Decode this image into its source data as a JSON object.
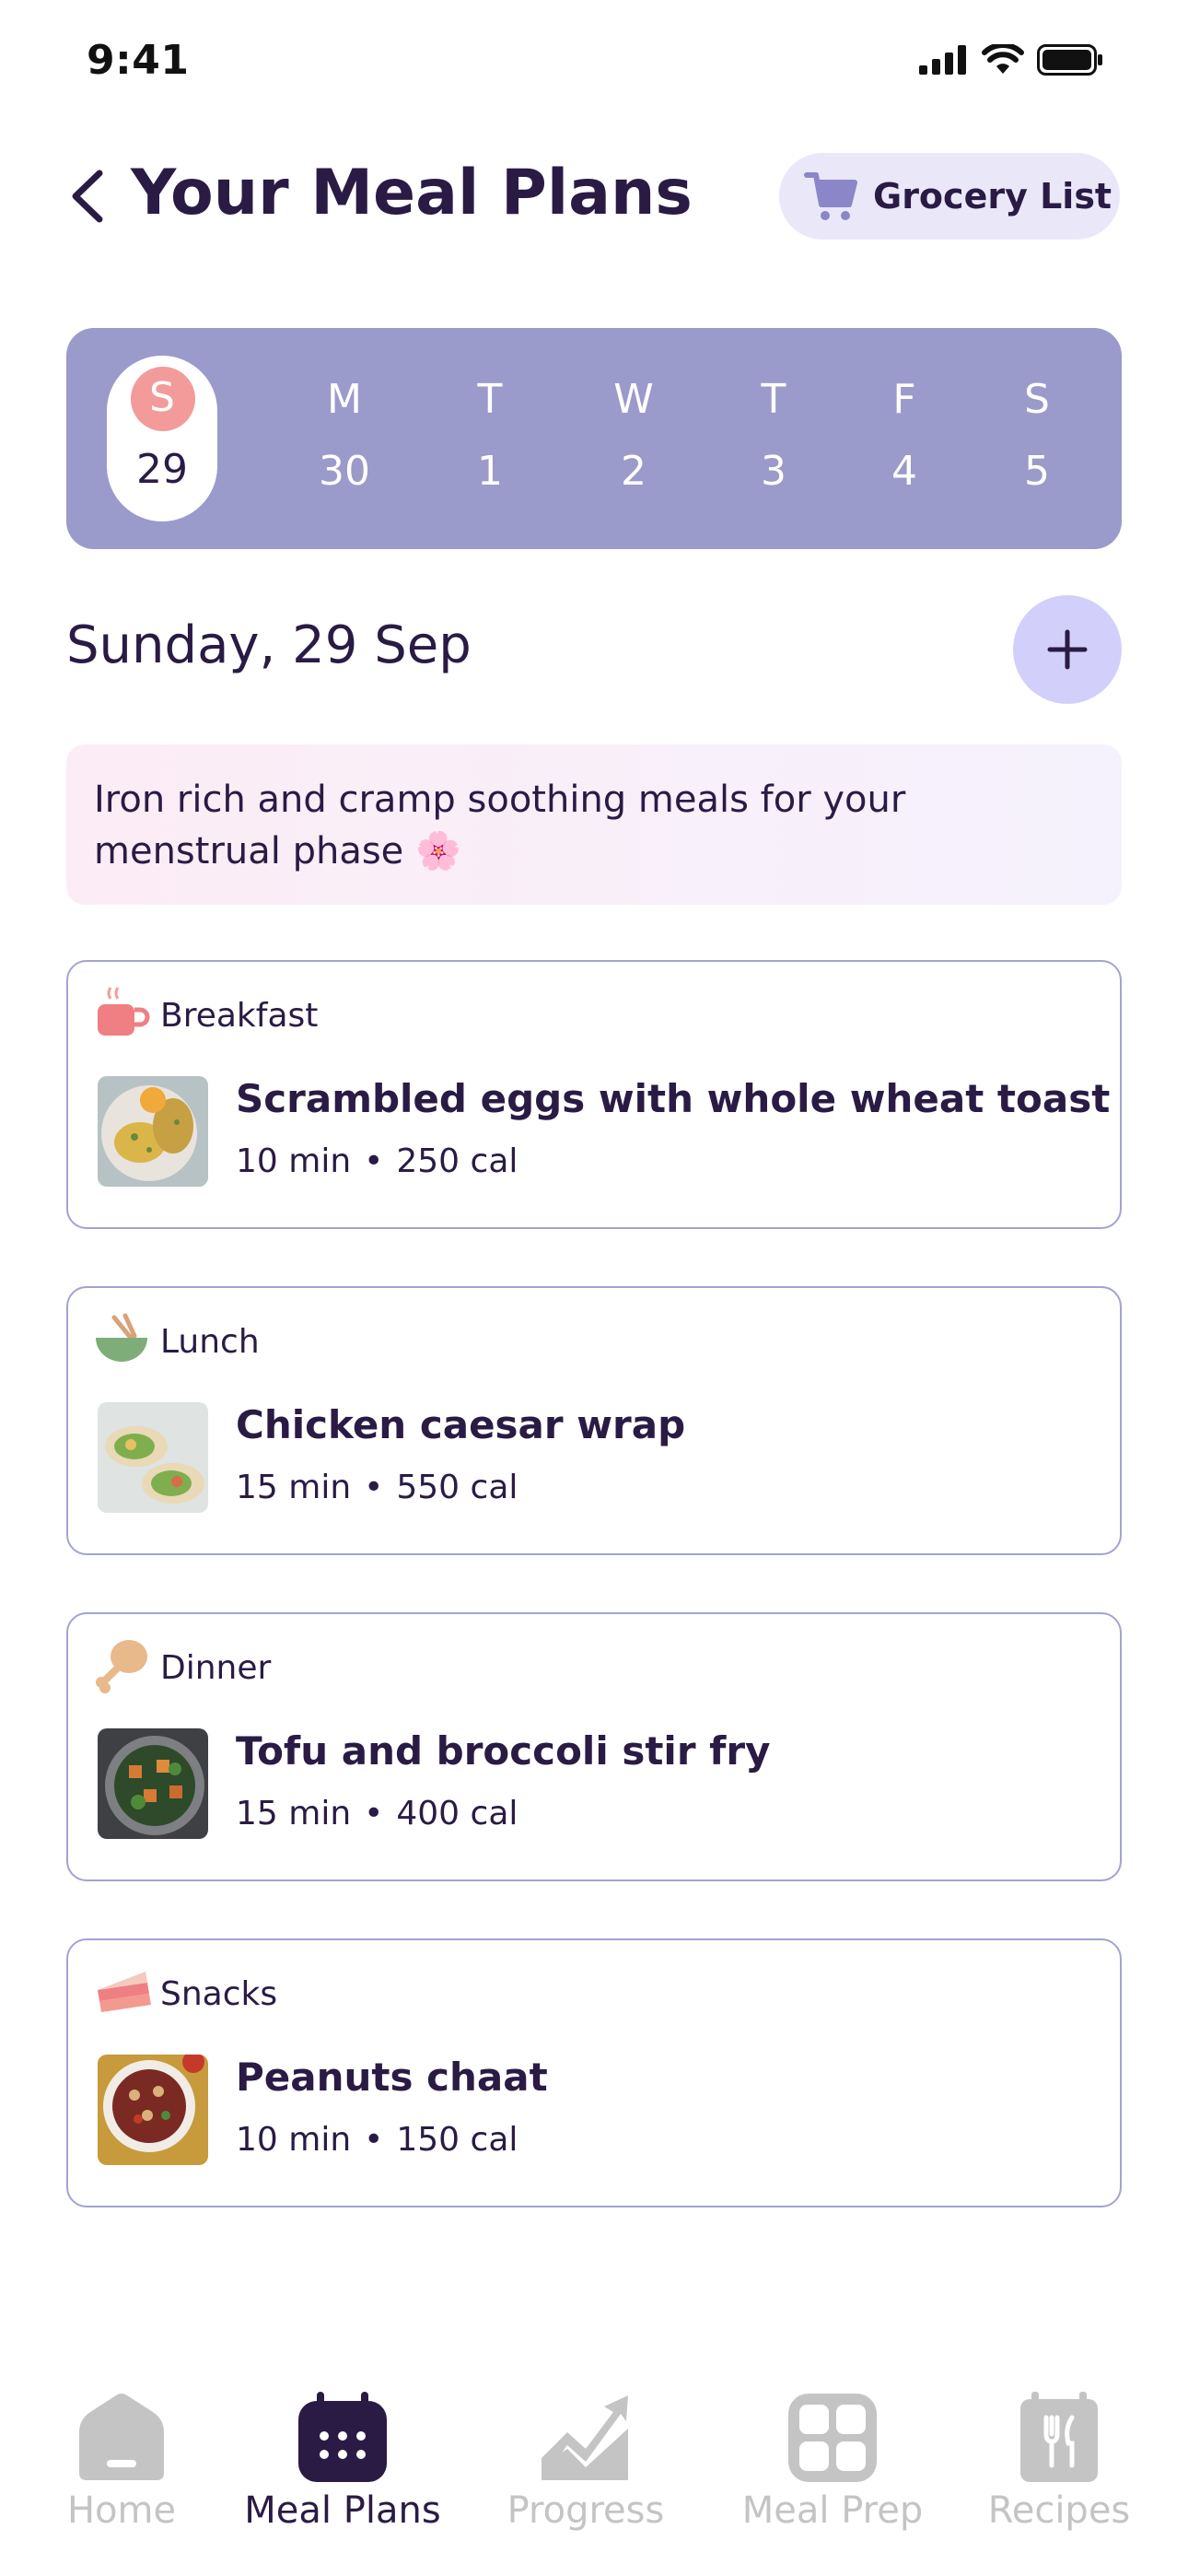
{
  "status_bar": {
    "time": "9:41"
  },
  "header": {
    "title": "Your Meal Plans",
    "grocery_label": "Grocery List"
  },
  "week": [
    {
      "letter": "S",
      "num": "29",
      "active": true
    },
    {
      "letter": "M",
      "num": "30"
    },
    {
      "letter": "T",
      "num": "1"
    },
    {
      "letter": "W",
      "num": "2"
    },
    {
      "letter": "T",
      "num": "3"
    },
    {
      "letter": "F",
      "num": "4"
    },
    {
      "letter": "S",
      "num": "5"
    }
  ],
  "selected_date": "Sunday, 29 Sep",
  "phase_note": "Iron rich and cramp soothing meals for your menstrual phase 🌸",
  "meals": [
    {
      "category": "Breakfast",
      "name": "Scrambled eggs with whole wheat toast",
      "time": "10 min",
      "cal": "250 cal",
      "icon": "mug-icon"
    },
    {
      "category": "Lunch",
      "name": "Chicken caesar wrap",
      "time": "15 min",
      "cal": "550 cal",
      "icon": "bowl-icon"
    },
    {
      "category": "Dinner",
      "name": "Tofu and broccoli stir fry",
      "time": "15 min",
      "cal": "400 cal",
      "icon": "drumstick-icon"
    },
    {
      "category": "Snacks",
      "name": "Peanuts chaat",
      "time": "10 min",
      "cal": "150 cal",
      "icon": "cake-slice-icon"
    }
  ],
  "tabs": [
    {
      "label": "Home",
      "icon": "home-icon"
    },
    {
      "label": "Meal Plans",
      "icon": "calendar-icon",
      "active": true
    },
    {
      "label": "Progress",
      "icon": "chart-icon"
    },
    {
      "label": "Meal Prep",
      "icon": "grid-icon"
    },
    {
      "label": "Recipes",
      "icon": "recipe-book-icon"
    }
  ],
  "colors": {
    "primary_text": "#2a1b45",
    "week_bg": "#9a9acb",
    "accent_dot": "#f39b9b",
    "add_button": "#d2d0fb",
    "card_border": "#a3a3d1",
    "inactive_tab": "#c4c4c4"
  }
}
